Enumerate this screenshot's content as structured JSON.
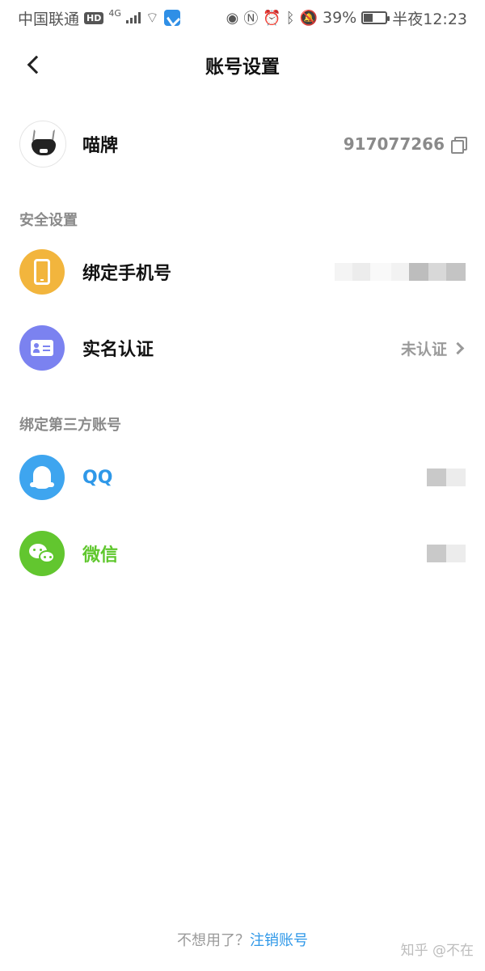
{
  "status_bar": {
    "carrier": "中国联通",
    "hd": "HD",
    "network": "4G",
    "battery": "39%",
    "battery_level": 0.39,
    "time": "半夜12:23"
  },
  "header": {
    "title": "账号设置"
  },
  "profile": {
    "name": "喵牌",
    "uid": "917077266"
  },
  "security": {
    "section_title": "安全设置",
    "phone_label": "绑定手机号",
    "realname_label": "实名认证",
    "realname_status": "未认证"
  },
  "third_party": {
    "section_title": "绑定第三方账号",
    "qq_label": "QQ",
    "wechat_label": "微信"
  },
  "footer": {
    "prompt": "不想用了？",
    "link": "注销账号"
  },
  "watermark": "知乎 @不在",
  "colors": {
    "phone_icon_bg": "#f2b53d",
    "realname_icon_bg": "#7b82f0",
    "qq_icon_bg": "#3ea5ef",
    "wechat_icon_bg": "#62c62f",
    "link_blue": "#2f98e8"
  }
}
